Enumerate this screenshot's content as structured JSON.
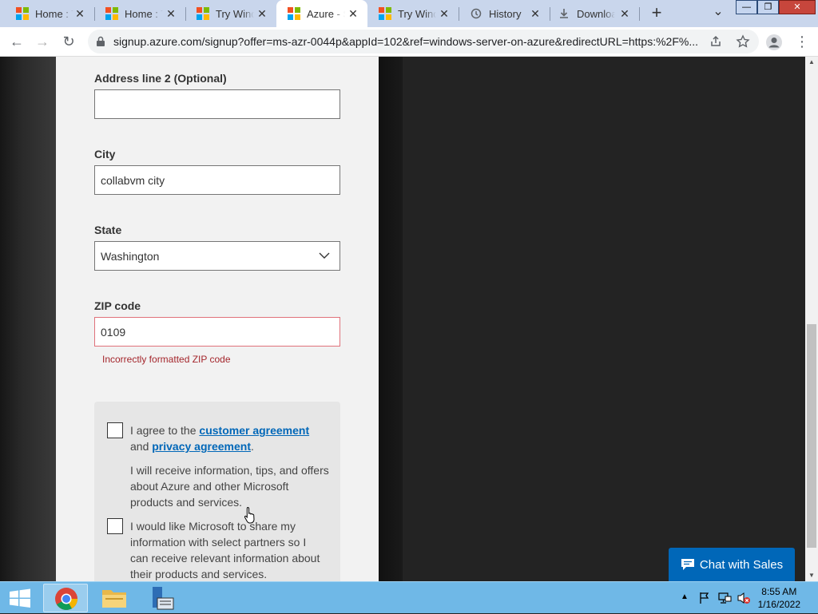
{
  "browser": {
    "tabs": [
      {
        "title": "Home : T",
        "icon": "microsoft-logo-icon"
      },
      {
        "title": "Home : T",
        "icon": "microsoft-logo-icon"
      },
      {
        "title": "Try Wind",
        "icon": "microsoft-logo-icon"
      },
      {
        "title": "Azure - S",
        "icon": "microsoft-logo-icon",
        "active": true
      },
      {
        "title": "Try Wind",
        "icon": "microsoft-logo-icon"
      },
      {
        "title": "History",
        "icon": "history-icon"
      },
      {
        "title": "Downloa",
        "icon": "download-icon"
      }
    ],
    "close_glyph": "✕",
    "new_tab_glyph": "+",
    "tab_search_glyph": "⌄",
    "url": "signup.azure.com/signup?offer=ms-azr-0044p&appId=102&ref=windows-server-on-azure&redirectURL=https:%2F%..."
  },
  "form": {
    "address2": {
      "label": "Address line 2 (Optional)",
      "value": ""
    },
    "city": {
      "label": "City",
      "value": "collabvm city"
    },
    "state": {
      "label": "State",
      "value": "Washington"
    },
    "zip": {
      "label": "ZIP code",
      "value": "0109",
      "error": "Incorrectly formatted ZIP code"
    },
    "agreement": {
      "prefix": "I agree to the ",
      "customer_link": "customer agreement",
      "and": "and ",
      "privacy_link": "privacy agreement",
      "period": ".",
      "info": "I will receive information, tips, and offers about Azure and other Microsoft products and services."
    },
    "share": {
      "text": "I would like Microsoft to share my information with select partners so I can receive relevant information about their products and services."
    }
  },
  "chat": {
    "label": "Chat with Sales"
  },
  "taskbar": {
    "time": "8:55 AM",
    "date": "1/16/2022"
  },
  "colors": {
    "accent": "#0067b8",
    "error": "#a4262c",
    "taskbar": "#6fb8e7"
  }
}
